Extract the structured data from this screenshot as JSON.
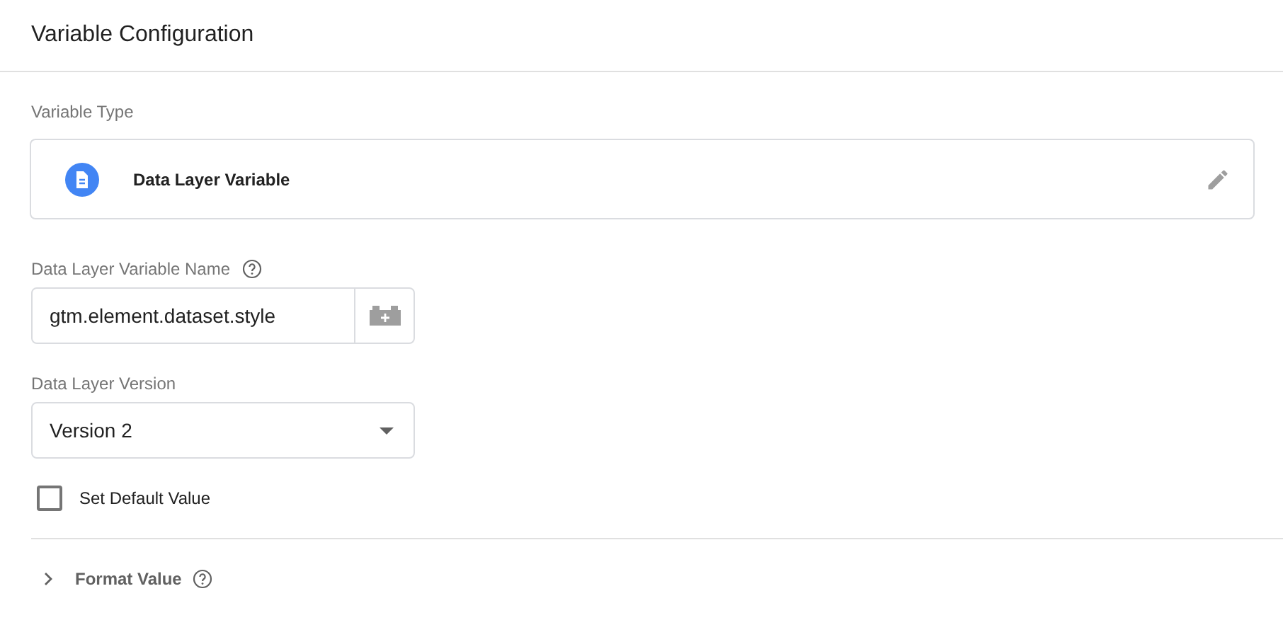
{
  "title": "Variable Configuration",
  "variable_type": {
    "label": "Variable Type",
    "value": "Data Layer Variable"
  },
  "name_field": {
    "label": "Data Layer Variable Name",
    "value": "gtm.element.dataset.style"
  },
  "version_field": {
    "label": "Data Layer Version",
    "value": "Version 2"
  },
  "default_value": {
    "label": "Set Default Value",
    "checked": false
  },
  "format_value": {
    "label": "Format Value",
    "expanded": false
  }
}
